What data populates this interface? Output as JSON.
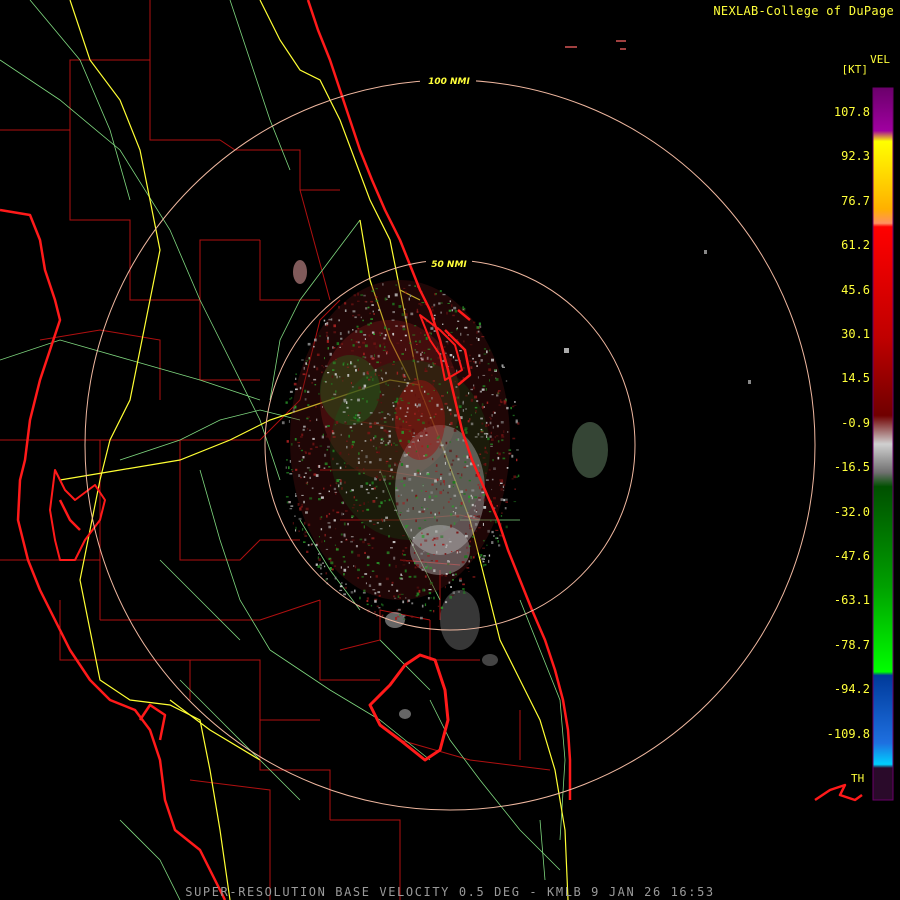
{
  "header": {
    "credit": "NEXLAB-College of DuPage"
  },
  "footer": {
    "caption": "SUPER-RESOLUTION BASE VELOCITY 0.5 DEG - KMLB 9 JAN 26 16:53"
  },
  "range_rings": {
    "inner_label": "50 NMI",
    "outer_label": "100 NMI"
  },
  "legend": {
    "product": "VEL",
    "unit": "[KT]",
    "ticks": [
      "107.8",
      "92.3",
      "76.7",
      "61.2",
      "45.6",
      "30.1",
      "14.5",
      "-0.9",
      "-16.5",
      "-32.0",
      "-47.6",
      "-63.1",
      "-78.7",
      "-94.2",
      "-109.8"
    ],
    "range_folded_label": "TH",
    "colors": {
      "outbound_extreme": "#8b008b",
      "outbound_high": "#ffff00",
      "outbound_mid": "#ff0000",
      "outbound_low": "#8b0000",
      "near_zero": "#ffffff",
      "inbound_low": "#006400",
      "inbound_mid": "#00ff00",
      "inbound_high": "#1e90ff",
      "range_folded": "#2a0a2a"
    }
  },
  "map_colors": {
    "coast": "#ff1a1a",
    "county": "#b01010",
    "highway": "#ffff33",
    "road": "#7fd87f",
    "ring": "#f0b8a0"
  }
}
